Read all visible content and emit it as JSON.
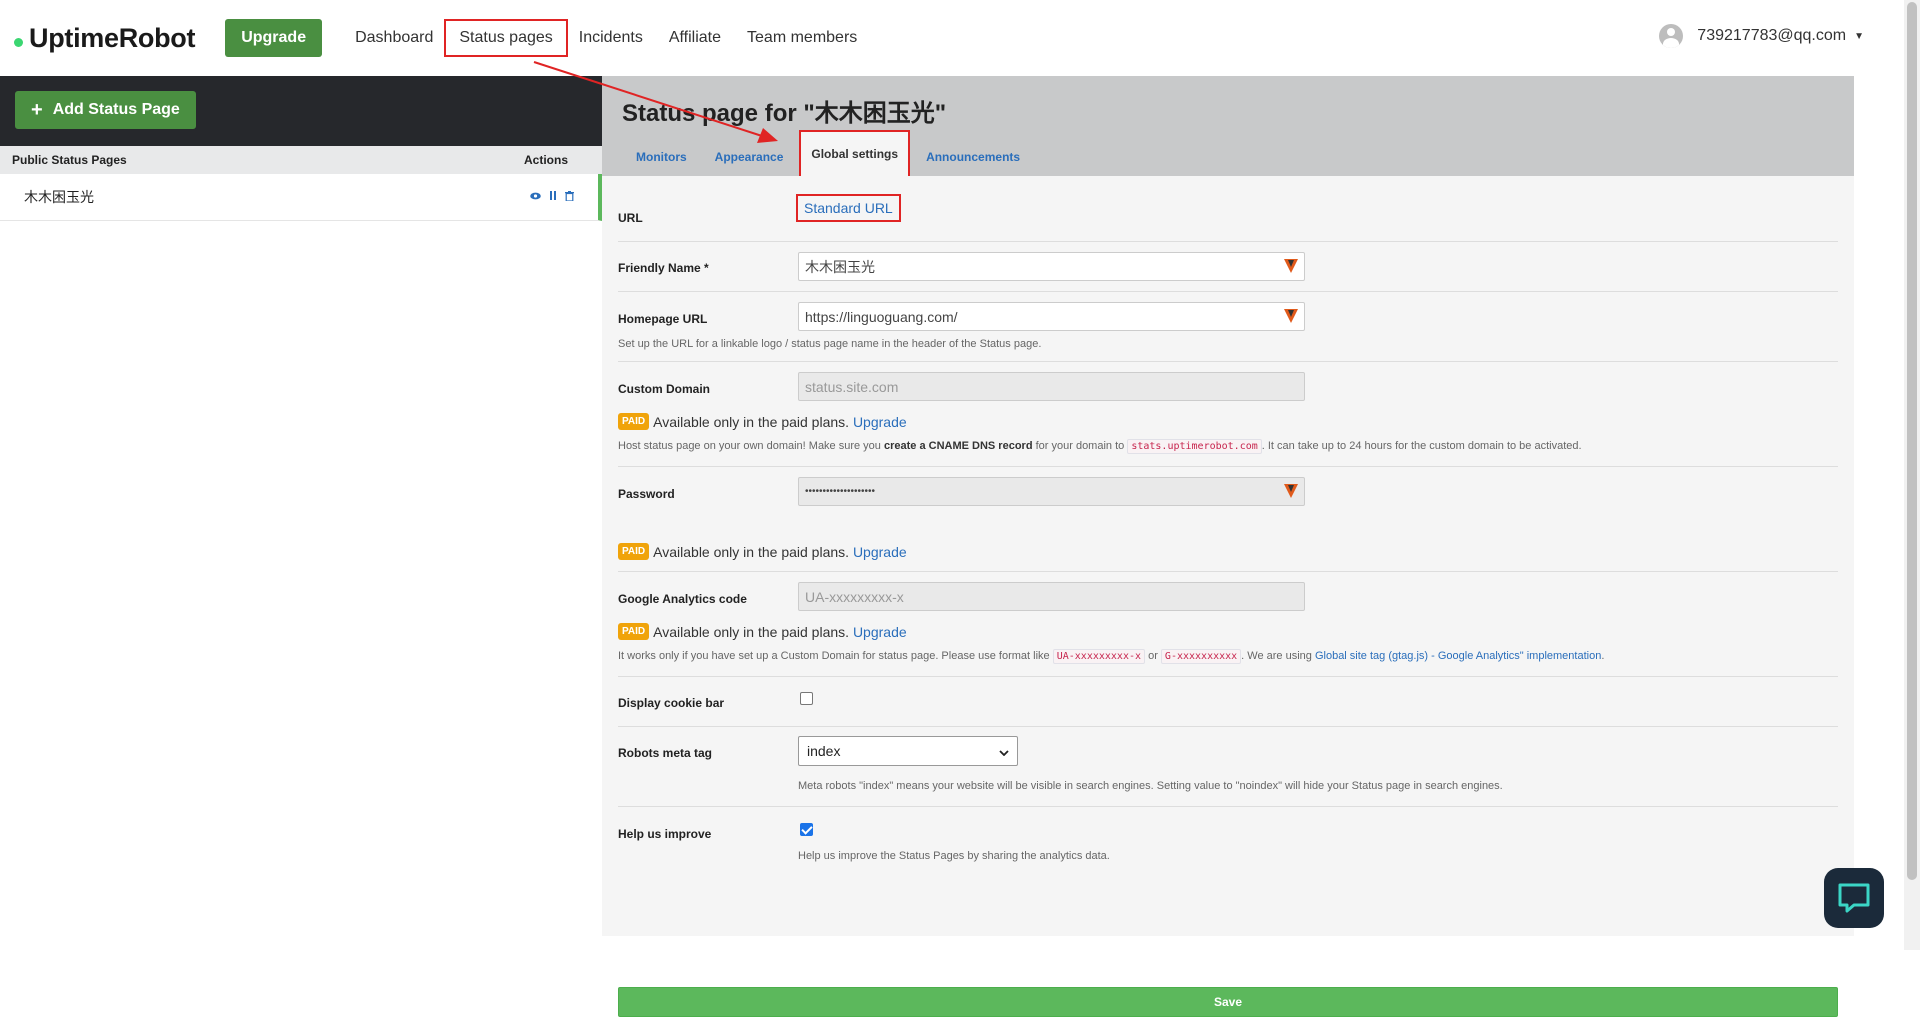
{
  "navbar": {
    "logo": "UptimeRobot",
    "upgrade_label": "Upgrade",
    "links": [
      "Dashboard",
      "Status pages",
      "Incidents",
      "Affiliate",
      "Team members"
    ],
    "account_email": "739217783@qq.com"
  },
  "sidebar": {
    "add_button": "Add Status Page",
    "col_name": "Public Status Pages",
    "col_actions": "Actions",
    "rows": [
      {
        "name": "木木困玉光"
      }
    ]
  },
  "status_page": {
    "title": "Status page for \"木木困玉光\"",
    "tabs": [
      "Monitors",
      "Appearance",
      "Global settings",
      "Announcements"
    ],
    "active_tab": "Global settings"
  },
  "form": {
    "url": {
      "label": "URL",
      "value": "Standard URL"
    },
    "friendly_name": {
      "label": "Friendly Name *",
      "value": "木木困玉光"
    },
    "homepage_url": {
      "label": "Homepage URL",
      "value": "https://linguoguang.com/",
      "help": "Set up the URL for a linkable logo / status page name in the header of the Status page."
    },
    "custom_domain": {
      "label": "Custom Domain",
      "placeholder": "status.site.com",
      "help_pre": "Host status page on your own domain! Make sure you ",
      "help_bold": "create a CNAME DNS record",
      "help_mid": " for your domain to ",
      "help_code": "stats.uptimerobot.com",
      "help_post": ". It can take up to 24 hours for the custom domain to be activated."
    },
    "password": {
      "label": "Password",
      "value": "••••••••••••••••••••"
    },
    "ga_code": {
      "label": "Google Analytics code",
      "placeholder": "UA-xxxxxxxxx-x",
      "help_pre": "It works only if you have set up a Custom Domain for status page. Please use format like ",
      "code1": "UA-xxxxxxxxx-x",
      "help_or": " or ",
      "code2": "G-xxxxxxxxxx",
      "help_mid": ". We are using ",
      "help_link": "Global site tag (gtag.js) - Google Analytics\" implementation",
      "help_end": "."
    },
    "cookie_bar": {
      "label": "Display cookie bar",
      "checked": false
    },
    "robots": {
      "label": "Robots meta tag",
      "value": "index",
      "help": "Meta robots \"index\" means your website will be visible in search engines. Setting value to \"noindex\" will hide your Status page in search engines."
    },
    "help_improve": {
      "label": "Help us improve",
      "checked": true,
      "help": "Help us improve the Status Pages by sharing the analytics data."
    },
    "paid": {
      "badge": "PAID",
      "text": "Available only in the paid plans.",
      "link": "Upgrade"
    },
    "save_label": "Save"
  },
  "colors": {
    "brand_green": "#4a8f41",
    "save_green": "#5cb85c",
    "link_blue": "#2a6ebb",
    "paid_orange": "#f0a30a",
    "annotation_red": "#e02424"
  }
}
